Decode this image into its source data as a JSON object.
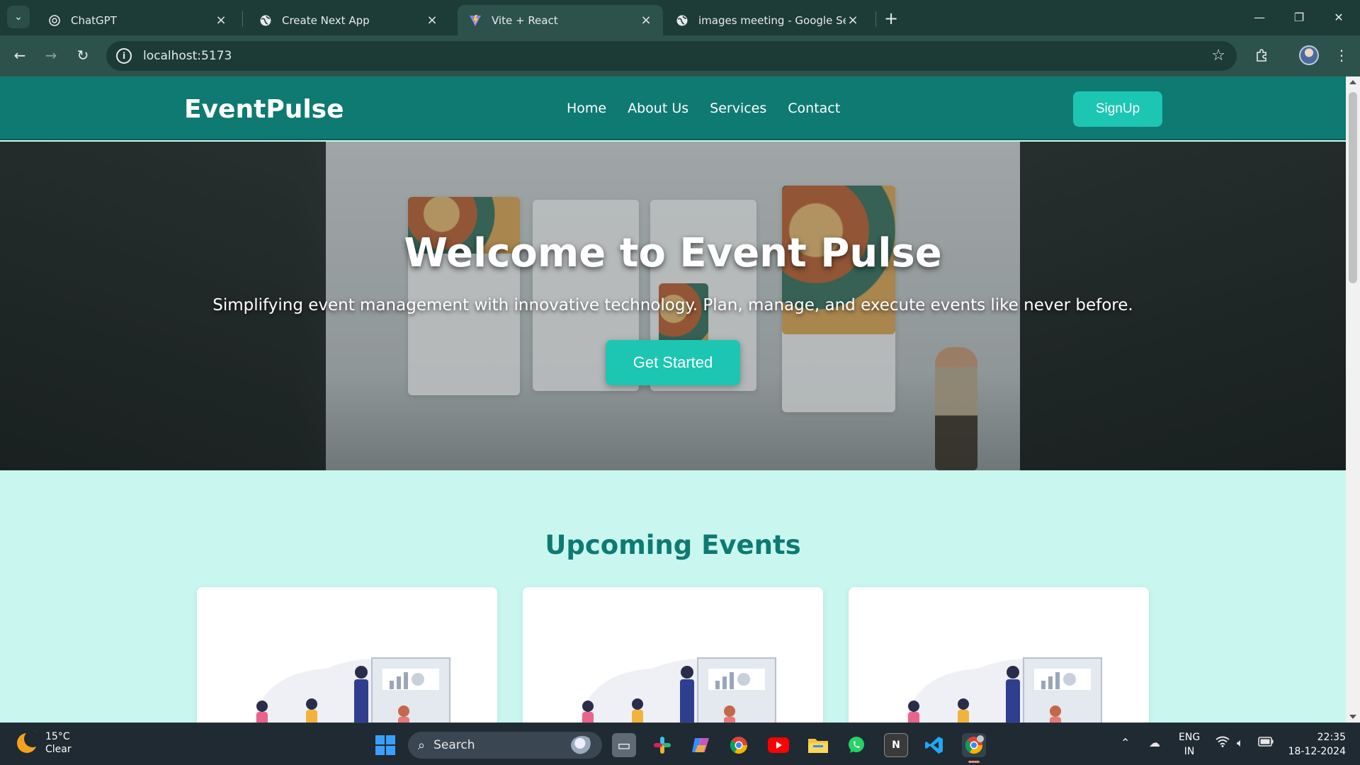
{
  "browser": {
    "tabs": [
      {
        "title": "ChatGPT",
        "icon": "chatgpt-icon",
        "active": false
      },
      {
        "title": "Create Next App",
        "icon": "globe-icon",
        "active": false
      },
      {
        "title": "Vite + React",
        "icon": "vite-icon",
        "active": true
      },
      {
        "title": "images meeting - Google Searc",
        "icon": "globe-icon",
        "active": false
      }
    ],
    "url": "localhost:5173"
  },
  "site": {
    "logo": "EventPulse",
    "nav": [
      "Home",
      "About Us",
      "Services",
      "Contact"
    ],
    "signup_label": "SignUp",
    "hero": {
      "title": "Welcome to Event Pulse",
      "subtitle": "Simplifying event management with innovative technology. Plan, manage, and execute events like never before.",
      "cta_label": "Get Started"
    },
    "section_title": "Upcoming Events",
    "colors": {
      "primary": "#0e7a72",
      "accent": "#1cc6b3",
      "background": "#c9f7ef"
    }
  },
  "taskbar": {
    "weather": {
      "temp": "15°C",
      "condition": "Clear",
      "badge": "1"
    },
    "search_placeholder": "Search",
    "lang_line1": "ENG",
    "lang_line2": "IN",
    "time": "22:35",
    "date": "18-12-2024"
  }
}
